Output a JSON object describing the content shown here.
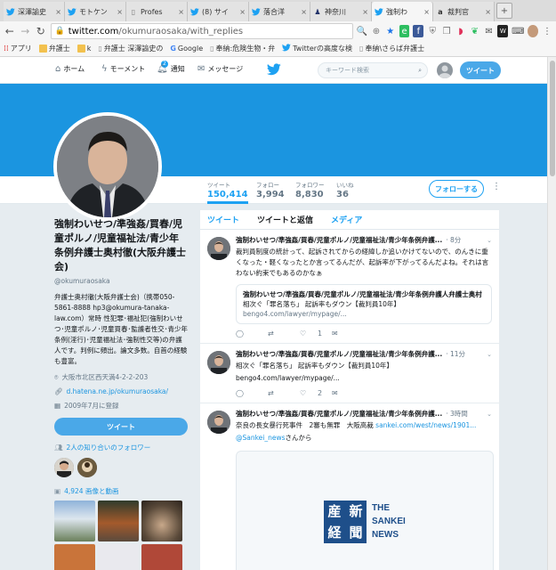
{
  "browser": {
    "tabs": [
      {
        "title": "深澤諭史",
        "icon": "twitter-icon",
        "active": false
      },
      {
        "title": "モトケン",
        "icon": "twitter-icon",
        "active": false
      },
      {
        "title": "Profes",
        "icon": "page-icon",
        "active": false
      },
      {
        "title": "(8) サイ",
        "icon": "twitter-icon",
        "active": false
      },
      {
        "title": "落合洋",
        "icon": "twitter-icon",
        "active": false
      },
      {
        "title": "神奈川",
        "icon": "pawn-icon",
        "active": false
      },
      {
        "title": "強制わ",
        "icon": "twitter-icon",
        "active": true
      },
      {
        "title": "裁判官",
        "icon": "amazon-icon",
        "active": false
      }
    ],
    "url_host": "twitter.com",
    "url_path": "/okumuraosaka/with_replies",
    "bookmarks": [
      "アプリ",
      "弁護士",
      "k",
      "弁護士 深澤諭史の",
      "Google",
      "奉納:危険生物・弁",
      "Twitterの高度な検",
      "奉納\\さらば弁護士"
    ]
  },
  "twitter": {
    "nav": {
      "home": "ホーム",
      "moments": "モーメント",
      "notifications": "通知",
      "notif_count": "2",
      "messages": "メッセージ",
      "search_placeholder": "キーワード検索",
      "tweet_button": "ツイート"
    },
    "stats": [
      {
        "label": "ツイート",
        "value": "150,414",
        "active": true
      },
      {
        "label": "フォロー",
        "value": "3,994",
        "active": false
      },
      {
        "label": "フォロワー",
        "value": "8,830",
        "active": false
      },
      {
        "label": "いいね",
        "value": "36",
        "active": false
      }
    ],
    "follow_button": "フォローする",
    "profile": {
      "name": "強制わいせつ/準強姦/買春/児童ポルノ/児童福祉法/青少年条例弁護士奥村徹(大阪弁護士会)",
      "handle": "@okumuraosaka",
      "bio": "弁護士奥村徹(大阪弁護士会)（携帯050-5861-8888 hp3@okumura-tanaka-law.com）常時 性犯罪･福祉犯(強制わいせつ･児童ポルノ･児童買春･監護者性交･青少年条例(淫行)･児童福祉法･強制性交等)の弁護人です。判例に頻出。論文多数。自首の経験も豊富。",
      "location": "大阪市北区西天満4-2-2-203",
      "website": "d.hatena.ne.jp/okumuraosaka/",
      "joined": "2009年7月に登録",
      "tweet_button": "ツイート",
      "known_followers": "2人の知り合いのフォロワー",
      "media": "4,924 画像と動画"
    },
    "timeline_tabs": [
      "ツイート",
      "ツイートと返信",
      "メディア"
    ],
    "tweets": [
      {
        "name": "強制わいせつ/準強姦/買春/児童ポルノ/児童福祉法/青少年条例弁護...",
        "time": "· 8分",
        "text": "裁判員制度の統計って、起訴されてからの経緯しか追いかけてないので、のんきに重くなった・軽くなったとか言ってるんだが、起訴率が下がってるんだよね。それは言わない約束でもあるのかなぁ",
        "card_title": "強制わいせつ/準強姦/買春/児童ポルノ/児童福祉法/青少年条例弁護人弁護士奥村",
        "card_desc": "相次ぐ「罪名落ち」 起訴率もダウン【裁判員10年】",
        "card_url": "bengo4.com/lawyer/mypage/...",
        "likes": "1"
      },
      {
        "name": "強制わいせつ/準強姦/買春/児童ポルノ/児童福祉法/青少年条例弁護...",
        "time": "· 11分",
        "text": "相次ぐ「罪名落ち」 起訴率もダウン【裁判員10年】",
        "link": "bengo4.com/lawyer/mypage/...",
        "likes": "2"
      },
      {
        "name": "強制わいせつ/準強姦/買春/児童ポルノ/児童福祉法/青少年条例弁護...",
        "time": "· 3時間",
        "text": "奈良の長女暴行死事件　2審も無罪　大阪高裁 ",
        "link": "sankei.com/west/news/1901...",
        "via_user": "@Sankei_news",
        "via_suffix": "さんから",
        "card_logo_jp": "産経新聞",
        "card_logo_en_1": "THE",
        "card_logo_en_2": "SANKEI",
        "card_logo_en_3": "NEWS"
      }
    ]
  },
  "colors": {
    "twitter_blue": "#1da1f2",
    "banner": "#1b95e0",
    "sankei_blue": "#1e4f8a"
  }
}
